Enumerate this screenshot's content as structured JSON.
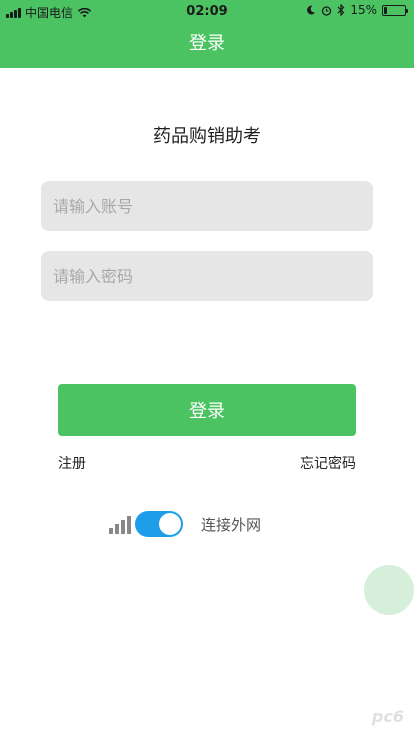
{
  "status_bar": {
    "carrier": "中国电信",
    "time": "02:09",
    "battery_text": "15%",
    "battery_level": 0.15,
    "icons": [
      "signal-icon",
      "wifi-icon",
      "moon-icon",
      "alarm-icon",
      "bluetooth-icon",
      "battery-icon"
    ]
  },
  "nav": {
    "title": "登录"
  },
  "app_title": "药品购销助考",
  "form": {
    "account_placeholder": "请输入账号",
    "account_value": "",
    "password_placeholder": "请输入密码",
    "password_value": ""
  },
  "login_button": "登录",
  "links": {
    "register": "注册",
    "forgot_password": "忘记密码"
  },
  "network": {
    "label": "连接外网",
    "enabled": true
  },
  "watermark": "pc6",
  "colors": {
    "primary_green": "#4cc363",
    "toggle_blue": "#1e9de8",
    "field_bg": "#e6e6e6"
  }
}
